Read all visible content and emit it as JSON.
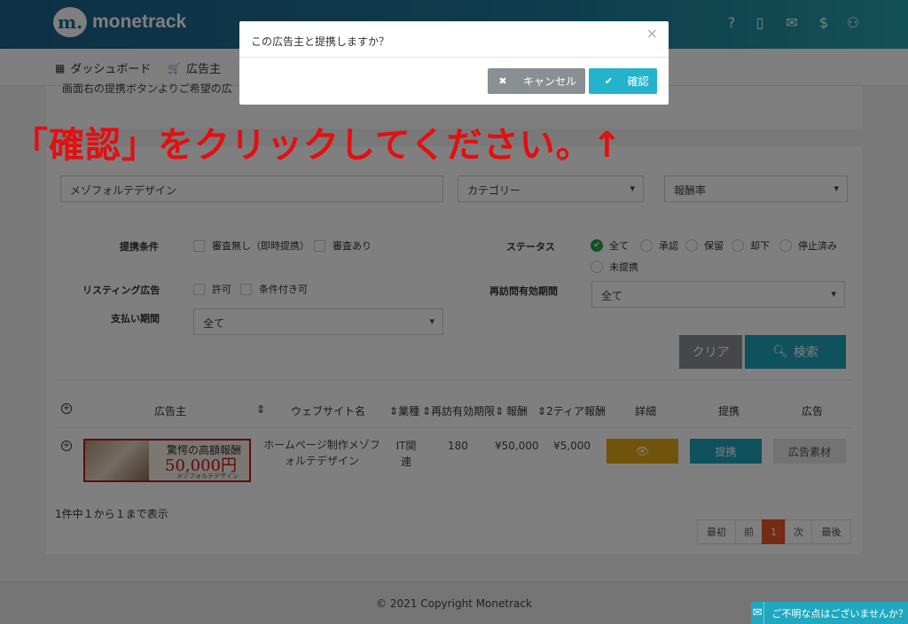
{
  "header": {
    "logo_mark": "m.",
    "logo_text": "monetrack",
    "icons": [
      {
        "name": "help-icon",
        "glyph": "?"
      },
      {
        "name": "book-icon",
        "glyph": "▯"
      },
      {
        "name": "mail-icon",
        "glyph": "✉"
      },
      {
        "name": "dollar-icon",
        "glyph": "$"
      },
      {
        "name": "user-icon",
        "glyph": "⚇"
      }
    ]
  },
  "nav": {
    "dashboard_icon": "▦",
    "dashboard": "ダッシュボード",
    "advertiser_icon": "🛒",
    "advertiser": "広告主"
  },
  "notice_clip": "画面右の提携ボタンよりご希望の広",
  "search": {
    "keyword": "メゾフォルテデザイン",
    "category": "カテゴリー",
    "reward_rate": "報酬率",
    "conditions_label": "提携条件",
    "cond_options": [
      "審査無し（即時提携）",
      "審査あり"
    ],
    "status_label": "ステータス",
    "status_options": [
      "全て",
      "承認",
      "保留",
      "却下",
      "停止済み",
      "未提携"
    ],
    "listing_label": "リスティング広告",
    "listing_options": [
      "許可",
      "条件付き可"
    ],
    "revisit_label": "再訪問有効期間",
    "revisit_value": "全て",
    "payment_label": "支払い期間",
    "payment_value": "全て",
    "clear_label": "クリア",
    "search_label": "検索"
  },
  "table": {
    "headers": [
      "広告主",
      "ウェブサイト名",
      "業種",
      "再訪有効期限",
      "報酬",
      "2ティア報酬",
      "詳細",
      "提携",
      "広告"
    ],
    "row": {
      "banner_headline": "驚愕の高額報酬",
      "banner_amount": "50,000円",
      "banner_sub": "メゾフォルテデザイン",
      "website": "ホームページ制作メゾフォルテデザイン",
      "industry": "IT関連",
      "revisit": "180",
      "reward": "¥50,000",
      "tier2": "¥5,000",
      "detail_icon": "👁",
      "partner_button": "提携",
      "ad_button": "広告素材"
    },
    "summary": "1件中１から１まで表示"
  },
  "pagination": [
    "最初",
    "前",
    "1",
    "次",
    "最後"
  ],
  "footer": {
    "copyright": "© 2021 Copyright Monetrack"
  },
  "modal": {
    "title": "この広告主と提携しますか？",
    "close": "×",
    "cancel_label": "キャンセル",
    "cancel_icon": "✖",
    "confirm_label": "確認",
    "confirm_icon": "✔"
  },
  "instruction": "「確認」をクリックしてください。↑",
  "chat": {
    "text": "ご不明な点はございませんか？",
    "icon": "✉"
  },
  "colors": {
    "header_start": "#1c5f89",
    "header_end": "#27a0ab",
    "teal": "#1fa3b8",
    "gold": "#e2a816",
    "danger_red": "#e30f10"
  }
}
